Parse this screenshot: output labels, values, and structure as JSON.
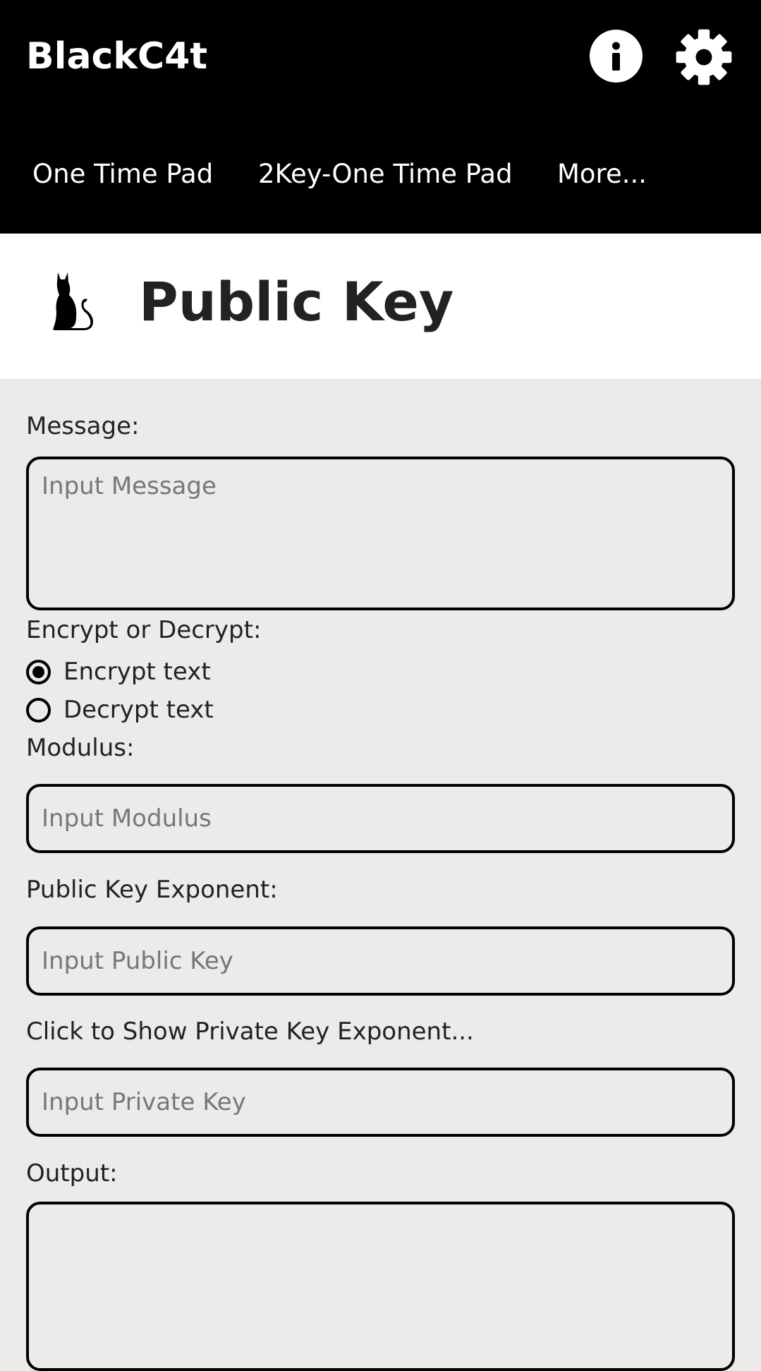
{
  "app": {
    "brand": "BlackC4t",
    "nav": [
      "One Time Pad",
      "2Key-One Time Pad",
      "More..."
    ]
  },
  "page": {
    "title": "Public Key"
  },
  "form": {
    "message_label": "Message:",
    "message_placeholder": "Input Message",
    "mode_label": "Encrypt or Decrypt:",
    "mode_options": [
      "Encrypt text",
      "Decrypt text"
    ],
    "mode_selected": "Encrypt text",
    "modulus_label": "Modulus:",
    "modulus_placeholder": "Input Modulus",
    "public_exp_label": "Public Key Exponent:",
    "public_exp_placeholder": "Input Public Key",
    "private_exp_label": "Click to Show Private Key Exponent...",
    "private_exp_placeholder": "Input Private Key",
    "output_label": "Output:",
    "output_value": ""
  },
  "icons": {
    "info": "info-icon",
    "settings": "gear-icon",
    "logo": "cat-icon"
  },
  "colors": {
    "header_bg": "#000000",
    "body_bg": "#ebebe9",
    "title_bg": "#ffffff"
  }
}
